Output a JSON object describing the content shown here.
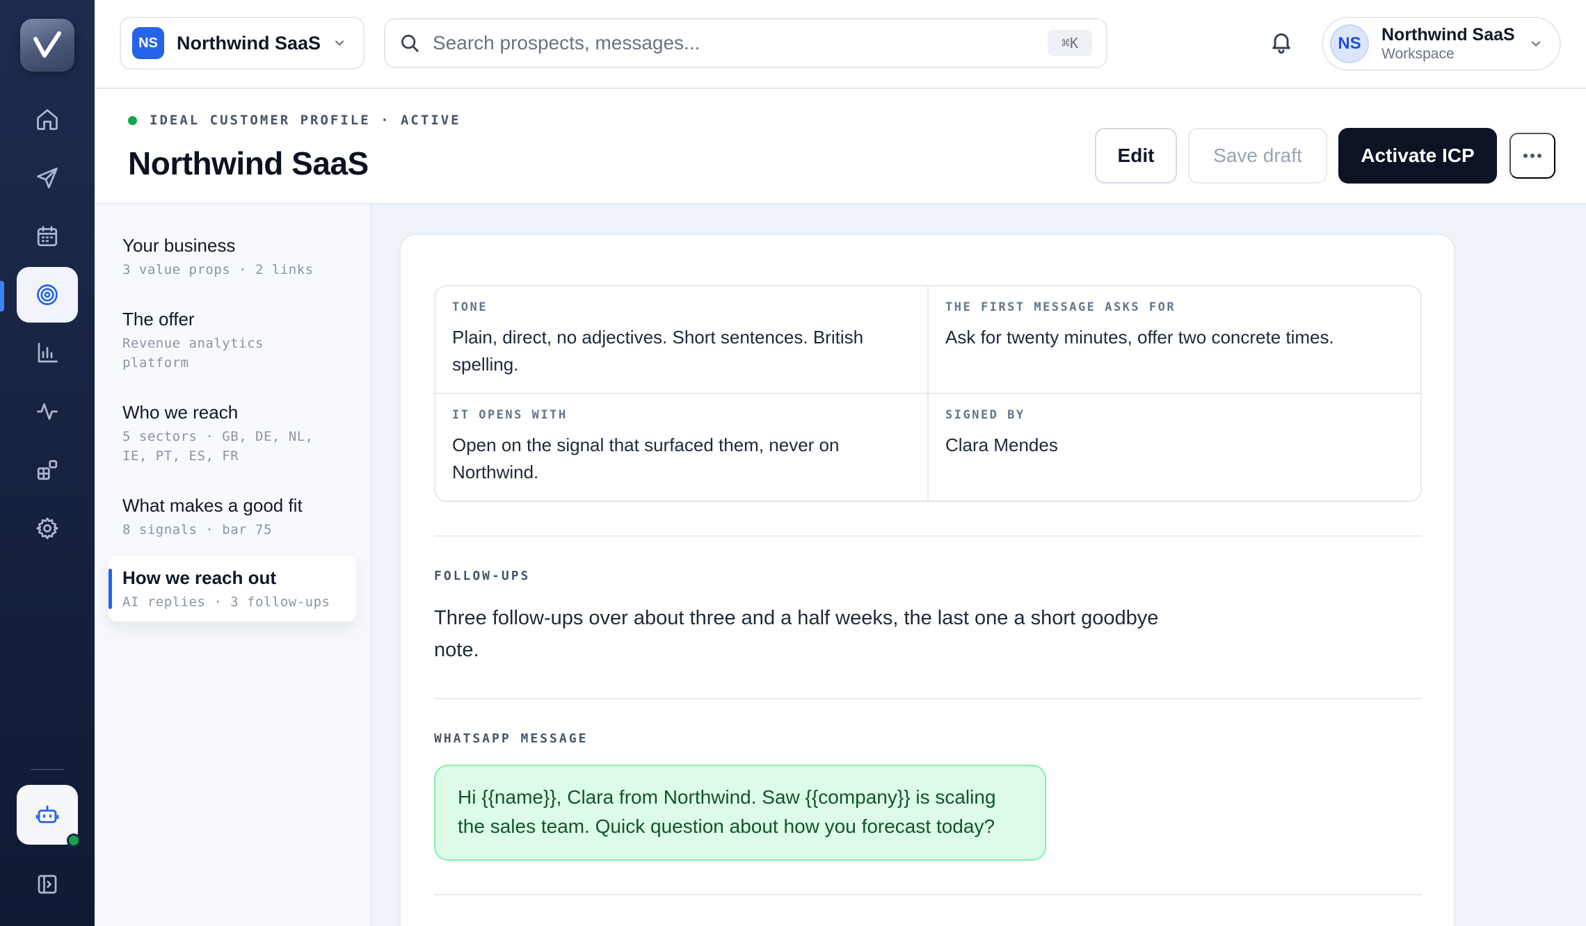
{
  "topbar": {
    "workspace_badge": "NS",
    "workspace_name": "Northwind SaaS",
    "search_placeholder": "Search prospects, messages...",
    "search_shortcut": "⌘K",
    "account_initials": "NS",
    "account_name": "Northwind SaaS",
    "account_sub": "Workspace"
  },
  "header": {
    "eyebrow": "IDEAL CUSTOMER PROFILE · ACTIVE",
    "title": "Northwind SaaS",
    "edit_label": "Edit",
    "save_draft_label": "Save draft",
    "activate_label": "Activate ICP"
  },
  "sections": [
    {
      "title": "Your business",
      "meta": "3 value props · 2 links"
    },
    {
      "title": "The offer",
      "meta": "Revenue analytics platform"
    },
    {
      "title": "Who we reach",
      "meta": "5 sectors · GB, DE, NL, IE, PT, ES, FR"
    },
    {
      "title": "What makes a good fit",
      "meta": "8 signals · bar 75"
    },
    {
      "title": "How we reach out",
      "meta": "AI replies · 3 follow-ups"
    }
  ],
  "outreach": {
    "tone_label": "TONE",
    "tone_value": "Plain, direct, no adjectives. Short sentences. British spelling.",
    "ask_label": "THE FIRST MESSAGE ASKS FOR",
    "ask_value": "Ask for twenty minutes, offer two concrete times.",
    "opens_label": "IT OPENS WITH",
    "opens_value": "Open on the signal that surfaced them, never on Northwind.",
    "signed_label": "SIGNED BY",
    "signed_value": "Clara Mendes",
    "followups_label": "FOLLOW-UPS",
    "followups_value": "Three follow-ups over about three and a half weeks, the last one a short goodbye note.",
    "whatsapp_label": "WHATSAPP MESSAGE",
    "whatsapp_value": "Hi {{name}}, Clara from Northwind. Saw {{company}} is scaling the sales team. Quick question about how you forecast today?"
  },
  "colors": {
    "accent": "#2563eb",
    "rail": "#1a2544",
    "primary_button": "#0b1324",
    "whatsapp_bg": "#dcfce7",
    "status_active": "#16a34a"
  },
  "icons": {
    "rail": [
      "home-icon",
      "send-icon",
      "calendar-icon",
      "target-icon",
      "bar-chart-icon",
      "activity-icon",
      "integrations-icon",
      "gear-icon",
      "bot-icon",
      "sidebar-toggle-icon"
    ]
  }
}
